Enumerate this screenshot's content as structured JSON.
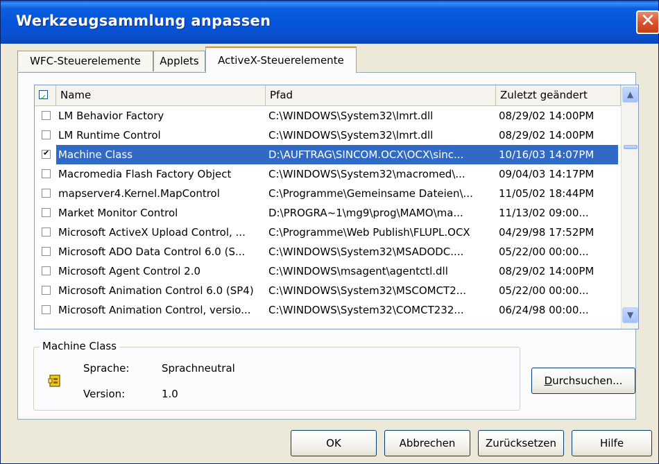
{
  "window": {
    "title": "Werkzeugsammlung anpassen",
    "close_glyph": "✕"
  },
  "tabs": [
    {
      "label": "WFC-Steuerelemente"
    },
    {
      "label": "Applets"
    },
    {
      "label": "ActiveX-Steuerelemente",
      "active": true
    }
  ],
  "list": {
    "columns": {
      "name": "Name",
      "path": "Pfad",
      "modified": "Zuletzt geändert"
    },
    "header_checked": true,
    "rows": [
      {
        "checked": false,
        "name": "LM Behavior Factory",
        "path": "C:\\WINDOWS\\System32\\lmrt.dll",
        "modified": "08/29/02 14:00PM"
      },
      {
        "checked": false,
        "name": "LM Runtime Control",
        "path": "C:\\WINDOWS\\System32\\lmrt.dll",
        "modified": "08/29/02 14:00PM"
      },
      {
        "checked": true,
        "selected": true,
        "name": "Machine Class",
        "path": "D:\\AUFTRAG\\SINCOM.OCX\\OCX\\sinc...",
        "modified": "10/16/03 14:07PM"
      },
      {
        "checked": false,
        "name": "Macromedia Flash Factory Object",
        "path": "C:\\WINDOWS\\System32\\macromed\\...",
        "modified": "09/04/03 14:17PM"
      },
      {
        "checked": false,
        "name": "mapserver4.Kernel.MapControl",
        "path": "C:\\Programme\\Gemeinsame Dateien\\...",
        "modified": "11/05/02 18:44PM"
      },
      {
        "checked": false,
        "name": "Market Monitor Control",
        "path": "D:\\PROGRA~1\\mg9\\prog\\MAMO\\ma...",
        "modified": "11/13/02 09:00..."
      },
      {
        "checked": false,
        "name": "Microsoft ActiveX Upload Control, ...",
        "path": "C:\\Programme\\Web Publish\\FLUPL.OCX",
        "modified": "04/29/98 17:52PM"
      },
      {
        "checked": false,
        "name": "Microsoft ADO Data Control 6.0 (S...",
        "path": "C:\\WINDOWS\\System32\\MSADODC....",
        "modified": "05/22/00 00:00..."
      },
      {
        "checked": false,
        "name": "Microsoft Agent Control 2.0",
        "path": "C:\\WINDOWS\\msagent\\agentctl.dll",
        "modified": "08/29/02 14:00PM"
      },
      {
        "checked": false,
        "name": "Microsoft Animation Control 6.0 (SP4)",
        "path": "C:\\WINDOWS\\System32\\MSCOMCT2...",
        "modified": "05/22/00 00:00..."
      },
      {
        "checked": false,
        "name": "Microsoft Animation Control, versio...",
        "path": "C:\\WINDOWS\\System32\\COMCT232...",
        "modified": "06/24/98 00:00..."
      }
    ]
  },
  "details": {
    "group_title": "Machine Class",
    "language_label": "Sprache:",
    "language_value": "Sprachneutral",
    "version_label": "Version:",
    "version_value": "1.0"
  },
  "buttons": {
    "browse_first": "D",
    "browse_rest": "urchsuchen...",
    "ok": "OK",
    "cancel": "Abbrechen",
    "reset": "Zurücksetzen",
    "help": "Hilfe"
  },
  "colors": {
    "title_blue": "#0653d8",
    "selection": "#316ac5",
    "close_red": "#d8542f",
    "dialog_bg": "#ece9d8"
  },
  "icons": {
    "component": "activex-component-icon"
  }
}
